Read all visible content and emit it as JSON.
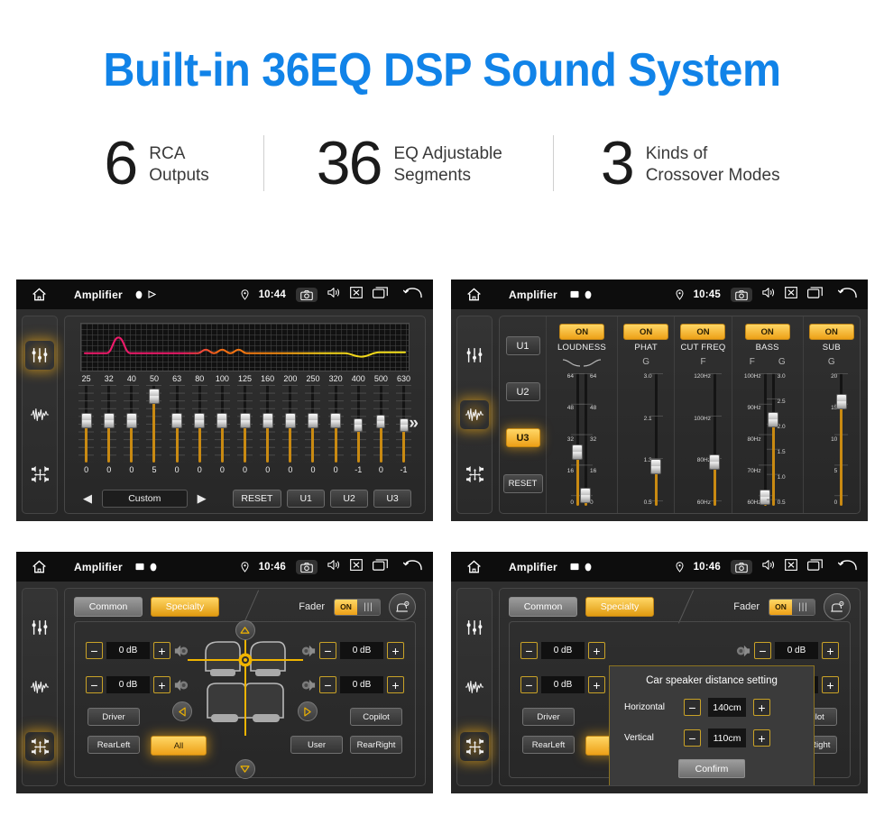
{
  "hero": {
    "title": "Built-in 36EQ DSP Sound System",
    "color": "#1183e8"
  },
  "stats": [
    {
      "number": "6",
      "text": "RCA\nOutputs"
    },
    {
      "number": "36",
      "text": "EQ Adjustable\nSegments"
    },
    {
      "number": "3",
      "text": "Kinds of\nCrossover Modes"
    }
  ],
  "statusbar": {
    "title": "Amplifier",
    "times": {
      "eq": "10:44",
      "crossover": "10:45",
      "balance": "10:46",
      "dialog": "10:46"
    },
    "icons": [
      "home-icon",
      "location-icon",
      "camera-icon",
      "volume-icon",
      "close-icon",
      "recents-icon",
      "back-icon"
    ]
  },
  "panel_eq": {
    "rail": [
      "equalizer-icon",
      "waveform-icon",
      "balance-icon"
    ],
    "rail_active": 0,
    "frequencies": [
      "25",
      "32",
      "40",
      "50",
      "63",
      "80",
      "100",
      "125",
      "160",
      "200",
      "250",
      "320",
      "400",
      "500",
      "630"
    ],
    "values": [
      "0",
      "0",
      "0",
      "5",
      "0",
      "0",
      "0",
      "0",
      "0",
      "0",
      "0",
      "0",
      "-1",
      "0",
      "-1"
    ],
    "preset": "Custom",
    "reset_label": "RESET",
    "user_presets": [
      "U1",
      "U2",
      "U3"
    ],
    "next_icon": "chevron-double-right-icon",
    "prev_icon": "triangle-left-icon",
    "fwd_icon": "triangle-right-icon",
    "curve_colors": [
      "#ef1a6a",
      "#f26a12",
      "#f2d11a"
    ]
  },
  "panel_crossover": {
    "rail_active": 1,
    "user_presets": [
      "U1",
      "U2",
      "U3"
    ],
    "active_preset": "U3",
    "reset_label": "RESET",
    "columns": [
      {
        "name": "LOUDNESS",
        "state": "ON",
        "sub": "curve-icons",
        "sliders": [
          {
            "scale": [
              "64",
              "48",
              "32",
              "16",
              "0"
            ],
            "pos": 0.38,
            "side": "left"
          },
          {
            "scale": [
              "64",
              "48",
              "32",
              "16",
              "0"
            ],
            "pos": 0.05,
            "side": "right"
          }
        ]
      },
      {
        "name": "PHAT",
        "state": "ON",
        "sub": "G",
        "sliders": [
          {
            "scale": [
              "3.0",
              "2.1",
              "1.3",
              "0.5"
            ],
            "pos": 0.27,
            "side": "left"
          }
        ]
      },
      {
        "name": "CUT FREQ",
        "state": "ON",
        "sub": "F",
        "sliders": [
          {
            "scale": [
              "120Hz",
              "100Hz",
              "80Hz",
              "60Hz"
            ],
            "pos": 0.3,
            "side": "left"
          }
        ]
      },
      {
        "name": "BASS",
        "state": "ON",
        "sub": "F G",
        "sliders": [
          {
            "scale": [
              "100Hz",
              "90Hz",
              "80Hz",
              "70Hz",
              "60Hz"
            ],
            "pos": 0.03,
            "side": "left"
          },
          {
            "scale": [
              "3.0",
              "2.5",
              "2.0",
              "1.5",
              "1.0",
              "0.5"
            ],
            "pos": 0.62,
            "side": "right"
          }
        ]
      },
      {
        "name": "SUB",
        "state": "ON",
        "sub": "G",
        "sliders": [
          {
            "scale": [
              "20",
              "15",
              "10",
              "5",
              "0"
            ],
            "pos": 0.76,
            "side": "left"
          }
        ]
      }
    ]
  },
  "panel_balance": {
    "rail_active": 2,
    "tabs": [
      {
        "label": "Common",
        "active": false
      },
      {
        "label": "Specialty",
        "active": true
      }
    ],
    "fader_label": "Fader",
    "fader_state": "ON",
    "car_icon": "car-seat-icon",
    "db_values": [
      "0 dB",
      "0 dB",
      "0 dB",
      "0 dB"
    ],
    "minus": "−",
    "plus": "+",
    "position_buttons": [
      {
        "label": "Driver",
        "active": false
      },
      {
        "label": "Copilot",
        "active": false
      },
      {
        "label": "RearLeft",
        "active": false
      },
      {
        "label": "All",
        "active": true
      },
      {
        "label": "User",
        "active": false
      },
      {
        "label": "RearRight",
        "active": false
      }
    ]
  },
  "dialog": {
    "title": "Car speaker distance setting",
    "rows": [
      {
        "label": "Horizontal",
        "value": "140cm"
      },
      {
        "label": "Vertical",
        "value": "110cm"
      }
    ],
    "confirm_label": "Confirm",
    "minus": "−",
    "plus": "+"
  }
}
